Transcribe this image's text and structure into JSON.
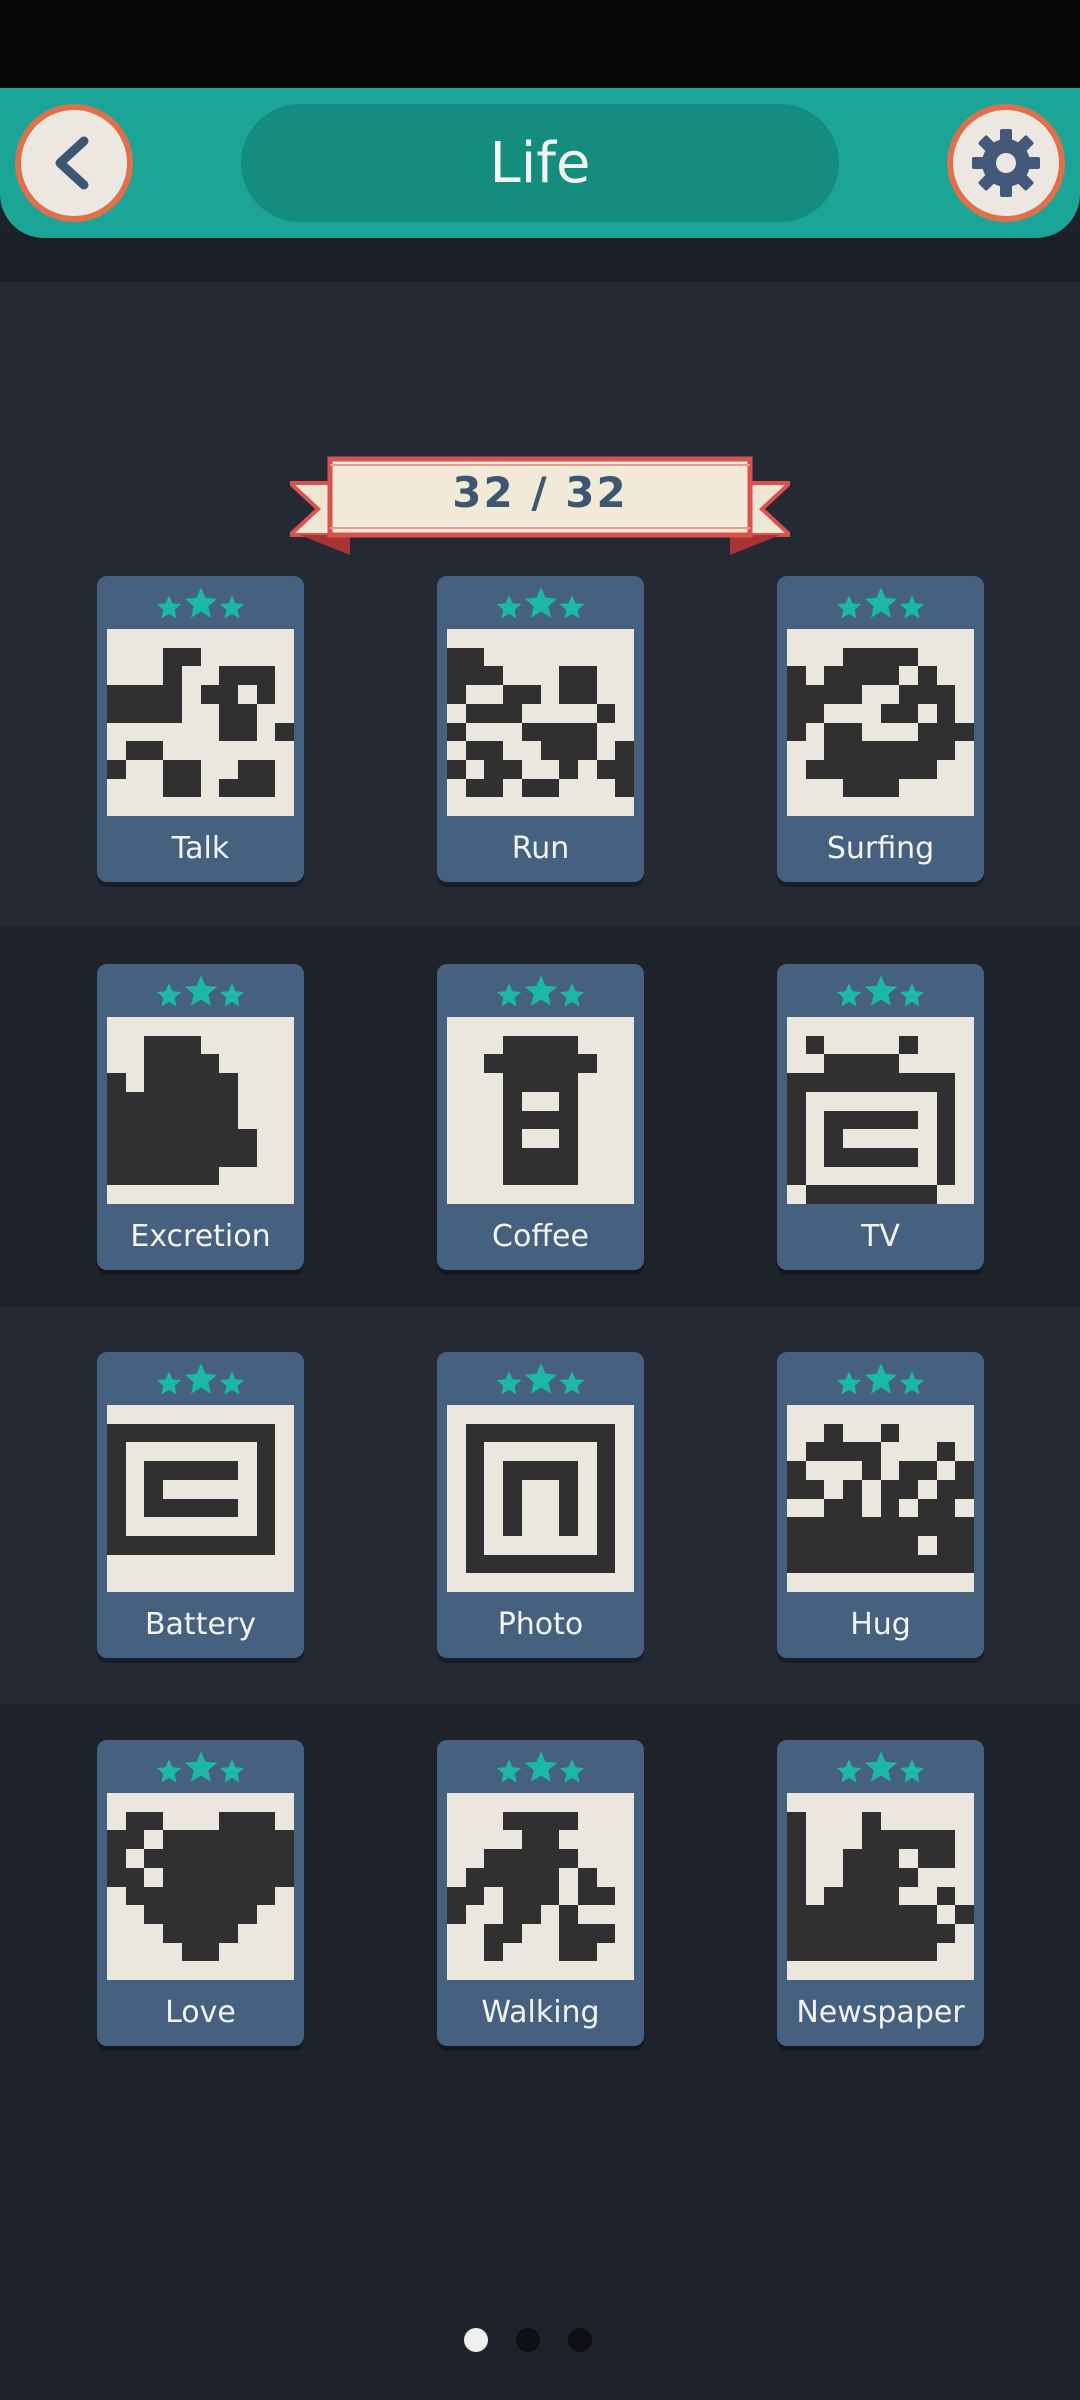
{
  "header": {
    "title": "Life"
  },
  "progress": {
    "label": "32 / 32"
  },
  "colors": {
    "teal": "#1aa596",
    "card": "#46607f",
    "star": "#1ab8a5",
    "ribbon": "#d9524e"
  },
  "icons": {
    "back": "chevron-left-icon",
    "settings": "gear-icon",
    "stars": "star-icon"
  },
  "puzzles": [
    {
      "label": "Talk",
      "stars": 3
    },
    {
      "label": "Run",
      "stars": 3
    },
    {
      "label": "Surfing",
      "stars": 3
    },
    {
      "label": "Excretion",
      "stars": 3
    },
    {
      "label": "Coffee",
      "stars": 3
    },
    {
      "label": "TV",
      "stars": 3
    },
    {
      "label": "Battery",
      "stars": 3
    },
    {
      "label": "Photo",
      "stars": 3
    },
    {
      "label": "Hug",
      "stars": 3
    },
    {
      "label": "Love",
      "stars": 3
    },
    {
      "label": "Walking",
      "stars": 3
    },
    {
      "label": "Newspaper",
      "stars": 3
    }
  ],
  "pagination": {
    "pages": 3,
    "current": 1
  }
}
